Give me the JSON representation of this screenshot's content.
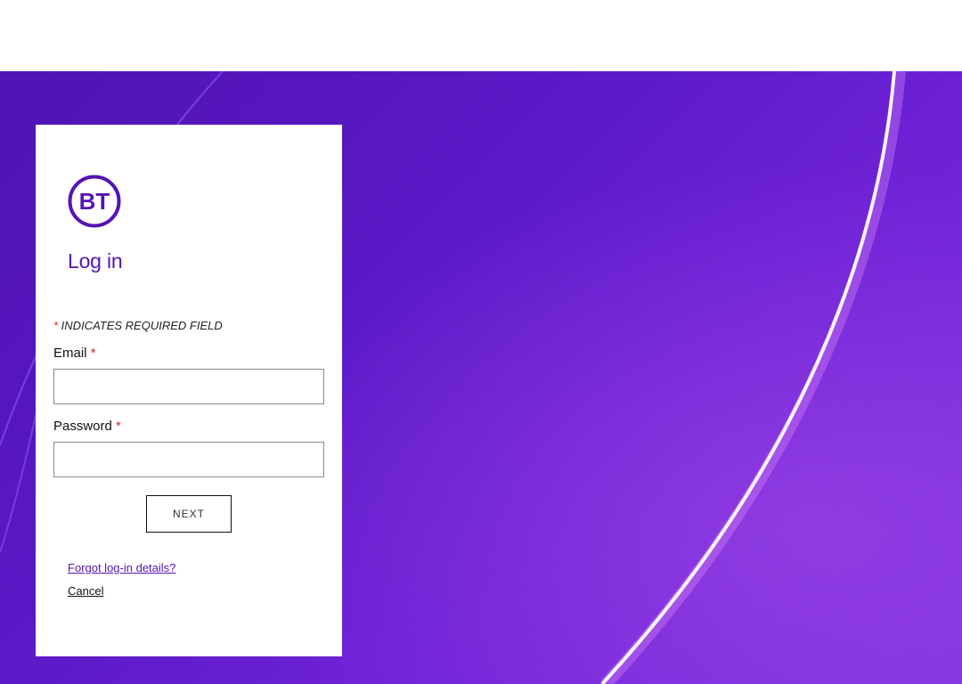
{
  "brand": {
    "logo_text": "BT",
    "color": "#5514b4"
  },
  "login": {
    "title": "Log in",
    "required_asterisk": "*",
    "required_note": " INDICATES REQUIRED FIELD",
    "email_label": "Email",
    "email_value": "",
    "password_label": "Password",
    "password_value": "",
    "next_label": "NEXT",
    "forgot_link": "Forgot log-in details?",
    "cancel_link": "Cancel"
  },
  "colors": {
    "background_purple": "#5a18c4",
    "required_red": "#d9262e",
    "link_purple": "#5514b4"
  }
}
